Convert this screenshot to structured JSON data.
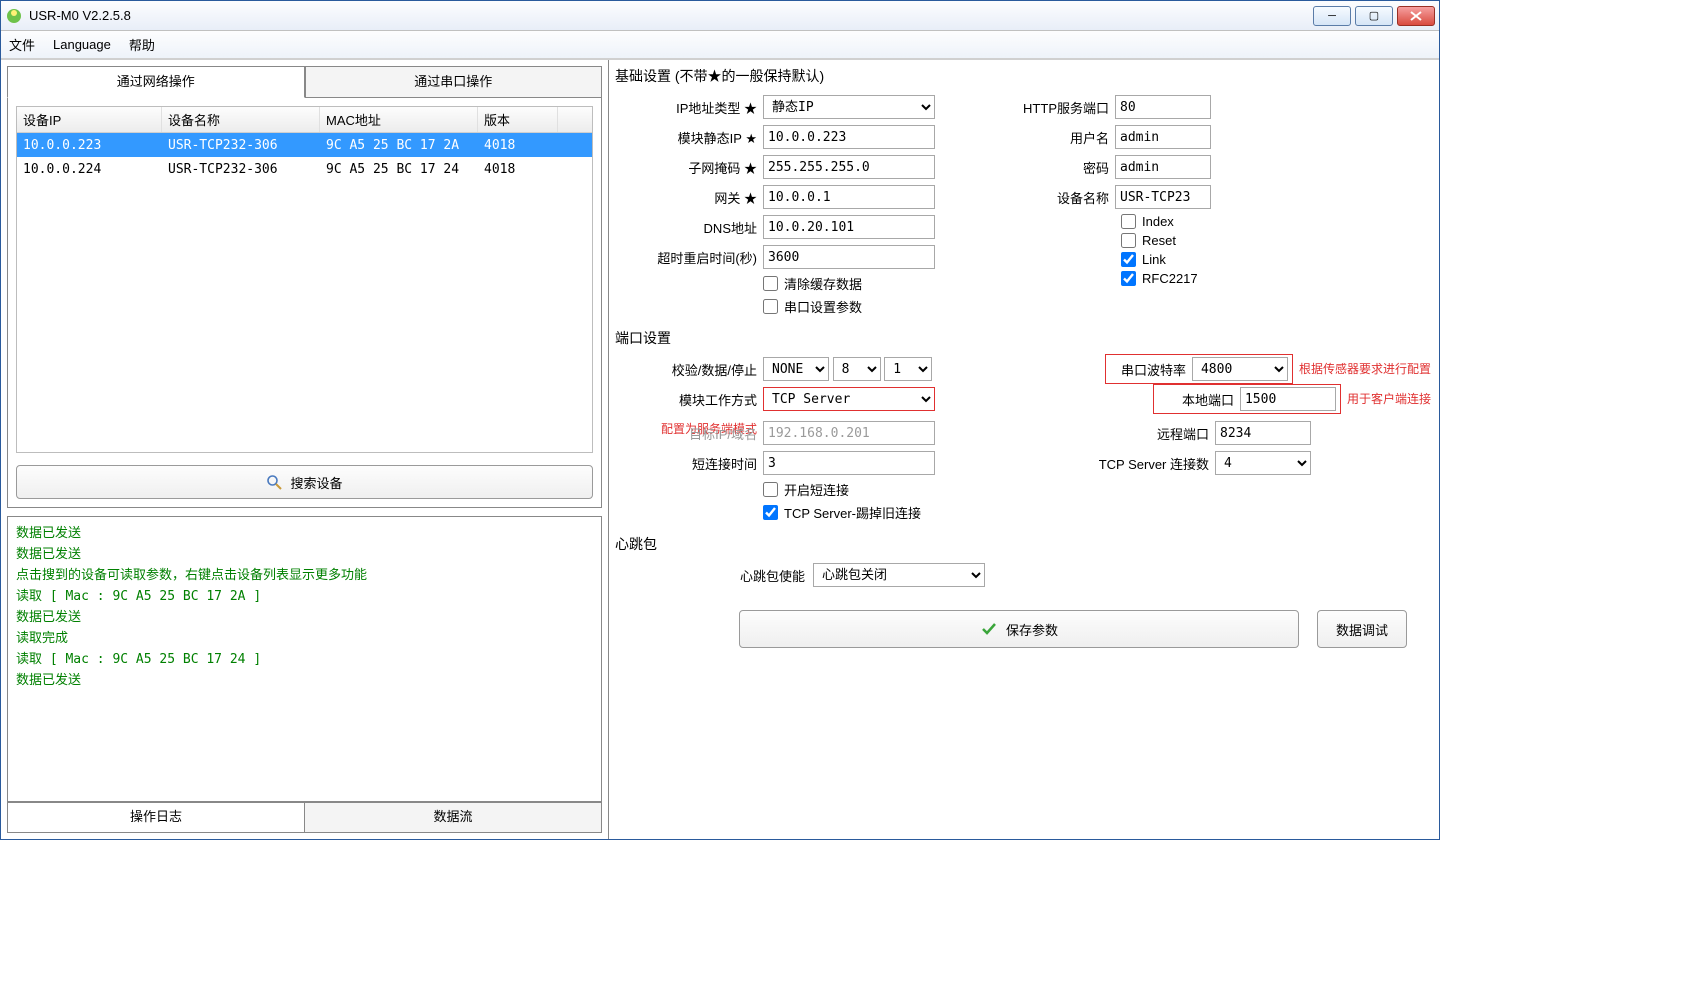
{
  "window": {
    "title": "USR-M0 V2.2.5.8"
  },
  "menu": {
    "file": "文件",
    "language": "Language",
    "help": "帮助"
  },
  "leftTabs": {
    "network": "通过网络操作",
    "serial": "通过串口操作"
  },
  "deviceGrid": {
    "headers": {
      "ip": "设备IP",
      "name": "设备名称",
      "mac": "MAC地址",
      "ver": "版本"
    },
    "rows": [
      {
        "ip": "10.0.0.223",
        "name": "USR-TCP232-306",
        "mac": "9C A5 25 BC 17 2A",
        "ver": "4018",
        "sel": true
      },
      {
        "ip": "10.0.0.224",
        "name": "USR-TCP232-306",
        "mac": "9C A5 25 BC 17 24",
        "ver": "4018",
        "sel": false
      }
    ]
  },
  "searchBtn": "搜索设备",
  "log": {
    "lines": [
      "数据已发送",
      "数据已发送",
      "点击搜到的设备可读取参数，右键点击设备列表显示更多功能",
      "读取 [ Mac : 9C A5 25 BC 17 2A ]",
      "数据已发送",
      "读取完成",
      "读取 [ Mac : 9C A5 25 BC 17 24 ]",
      "数据已发送"
    ],
    "tabLog": "操作日志",
    "tabData": "数据流"
  },
  "basic": {
    "title": "基础设置",
    "hint": "(不带★的一般保持默认)",
    "ipTypeLbl": "IP地址类型 ★",
    "ipType": "静态IP",
    "staticIpLbl": "模块静态IP ★",
    "staticIp": "10.0.0.223",
    "maskLbl": "子网掩码 ★",
    "mask": "255.255.255.0",
    "gwLbl": "网关 ★",
    "gw": "10.0.0.1",
    "dnsLbl": "DNS地址",
    "dns": "10.0.20.101",
    "timeoutLbl": "超时重启时间(秒)",
    "timeout": "3600",
    "clearCache": "清除缓存数据",
    "serialParam": "串口设置参数",
    "httpPortLbl": "HTTP服务端口",
    "httpPort": "80",
    "userLbl": "用户名",
    "user": "admin",
    "pwdLbl": "密码",
    "pwd": "admin",
    "devNameLbl": "设备名称",
    "devName": "USR-TCP23",
    "cbIndex": "Index",
    "cbReset": "Reset",
    "cbLink": "Link",
    "cbRfc": "RFC2217"
  },
  "port": {
    "title": "端口设置",
    "parityLbl": "校验/数据/停止",
    "parity": "NONE",
    "databits": "8",
    "stopbits": "1",
    "baudLbl": "串口波特率",
    "baud": "4800",
    "modeLbl": "模块工作方式",
    "mode": "TCP Server",
    "modeHint": "配置为服务端模式",
    "targetLbl": "目标IP/域名",
    "target": "192.168.0.201",
    "localPortLbl": "本地端口",
    "localPort": "1500",
    "remotePortLbl": "远程端口",
    "remotePort": "8234",
    "shortTimeLbl": "短连接时间",
    "shortTime": "3",
    "tcpCountLbl": "TCP Server 连接数",
    "tcpCount": "4",
    "cbShort": "开启短连接",
    "cbKick": "TCP Server-踢掉旧连接",
    "noteBaud": "根据传感器要求进行配置",
    "noteLocal": "用于客户端连接"
  },
  "heartbeat": {
    "title": "心跳包",
    "enableLbl": "心跳包使能",
    "enableVal": "心跳包关闭"
  },
  "buttons": {
    "save": "保存参数",
    "debug": "数据调试"
  }
}
